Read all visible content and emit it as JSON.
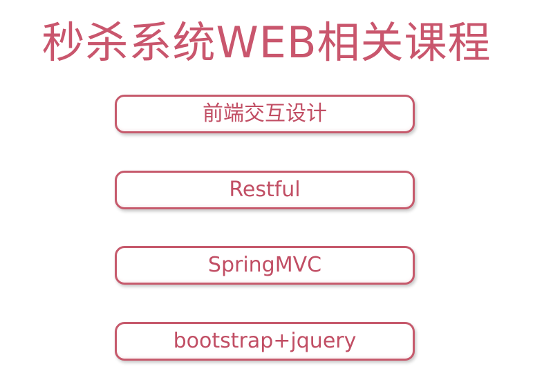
{
  "slide": {
    "title": "秒杀系统WEB相关课程",
    "items": [
      {
        "label": "前端交互设计"
      },
      {
        "label": "Restful"
      },
      {
        "label": "SpringMVC"
      },
      {
        "label": "bootstrap+jquery"
      }
    ]
  },
  "colors": {
    "title_text": "#c9566d",
    "box_border": "#c65a6c",
    "box_text": "#c14e64",
    "background": "#ffffff"
  }
}
